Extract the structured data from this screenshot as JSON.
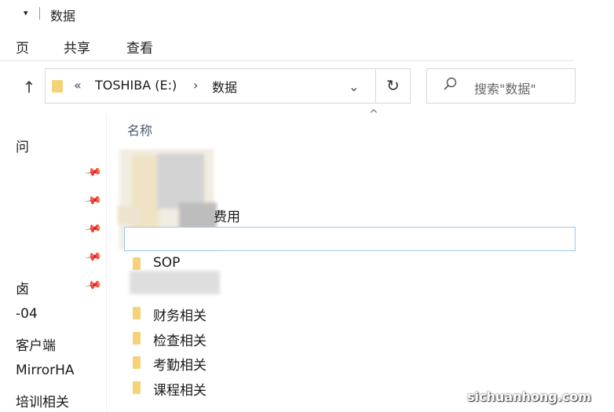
{
  "window": {
    "title": "数据",
    "qa_arrow": "▾"
  },
  "ribbon": {
    "tabs": [
      "页",
      "共享",
      "查看"
    ]
  },
  "address": {
    "chevrons": "«",
    "drive": "TOSHIBA (E:)",
    "separator": "›",
    "folder": "数据",
    "dropdown": "⌄"
  },
  "refresh_glyph": "↻",
  "search": {
    "placeholder": "搜索\"数据\"",
    "icon": "search-icon"
  },
  "navpane": {
    "items": [
      "问",
      "卤",
      "-04",
      "客户端",
      "MirrorHA",
      "培训相关"
    ],
    "pin": "📌"
  },
  "list": {
    "column_header": "名称",
    "sort_arrow": "^",
    "partial_text": "费用",
    "files": [
      "SOP",
      "财务相关",
      "检查相关",
      "考勤相关",
      "课程相关"
    ]
  },
  "watermark": {
    "text": "sichuanhong.com"
  },
  "colors": {
    "folder": "#f5d27a",
    "selection_border": "#99c9ef",
    "header_text": "#4a5a70"
  }
}
